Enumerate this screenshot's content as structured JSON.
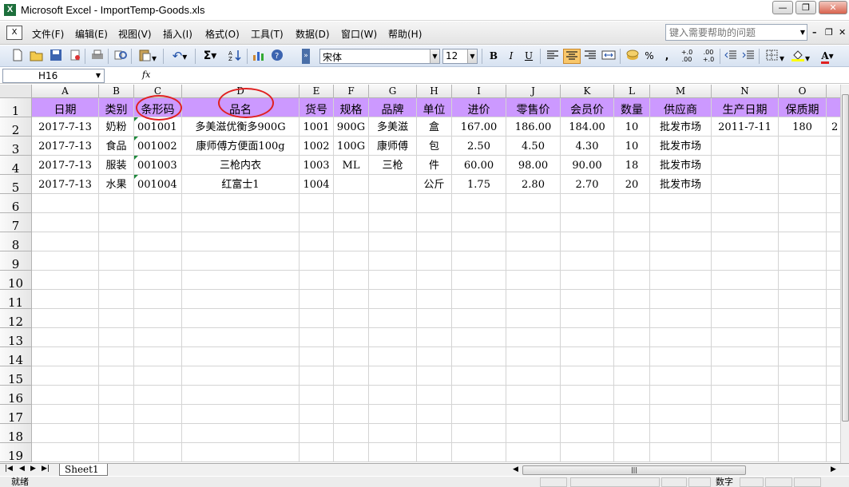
{
  "window": {
    "title": "Microsoft Excel - ImportTemp-Goods.xls",
    "app_icon_letter": "X",
    "buttons": {
      "minimize": "—",
      "restore": "❐",
      "close": "✕"
    }
  },
  "menu": {
    "items": [
      "文件(F)",
      "编辑(E)",
      "视图(V)",
      "插入(I)",
      "格式(O)",
      "工具(T)",
      "数据(D)",
      "窗口(W)",
      "帮助(H)"
    ],
    "help_placeholder": "键入需要帮助的问题"
  },
  "toolbar": {
    "font_name": "宋体",
    "font_size": "12",
    "bold_label": "B",
    "italic_label": "I",
    "underline_label": "U",
    "sum_label": "Σ",
    "percent_label": "%",
    "comma_label": ",",
    "inc_dec_label": "+.0 .00",
    "dec_dec_label": ".00 +.0"
  },
  "formula_bar": {
    "name_box": "H16",
    "fx_label": "fx"
  },
  "grid": {
    "columns": [
      "A",
      "B",
      "C",
      "D",
      "E",
      "F",
      "G",
      "H",
      "I",
      "J",
      "K",
      "L",
      "M",
      "N",
      "O"
    ],
    "rows": [
      "1",
      "2",
      "3",
      "4",
      "5",
      "6",
      "7",
      "8",
      "9",
      "10",
      "11",
      "12",
      "13",
      "14",
      "15",
      "16",
      "17",
      "18",
      "19"
    ],
    "header_row": [
      "日期",
      "类别",
      "条形码",
      "品名",
      "货号",
      "规格",
      "品牌",
      "单位",
      "进价",
      "零售价",
      "会员价",
      "数量",
      "供应商",
      "生产日期",
      "保质期"
    ],
    "header_color": "#cc99ff",
    "data_rows": [
      [
        "2017-7-13",
        "奶粉",
        "001001",
        "多美滋优衡多900G",
        "1001",
        "900G",
        "多美滋",
        "盒",
        "167.00",
        "186.00",
        "184.00",
        "10",
        "批发市场",
        "2011-7-11",
        "180"
      ],
      [
        "2017-7-13",
        "食品",
        "001002",
        "康师傅方便面100g",
        "1002",
        "100G",
        "康师傅",
        "包",
        "2.50",
        "4.50",
        "4.30",
        "10",
        "批发市场",
        "",
        ""
      ],
      [
        "2017-7-13",
        "服装",
        "001003",
        "三枪内衣",
        "1003",
        "ML",
        "三枪",
        "件",
        "60.00",
        "98.00",
        "90.00",
        "18",
        "批发市场",
        "",
        ""
      ],
      [
        "2017-7-13",
        "水果",
        "001004",
        "红富士1",
        "1004",
        "",
        "",
        "公斤",
        "1.75",
        "2.80",
        "2.70",
        "20",
        "批发市场",
        "",
        ""
      ]
    ],
    "overflow_text": "2",
    "circle_color": "#e02020",
    "error_marker_color": "#1f8a3c"
  },
  "sheets": {
    "tabs": [
      "Sheet1"
    ]
  },
  "status": {
    "left": "就绪",
    "mode": "数字"
  }
}
